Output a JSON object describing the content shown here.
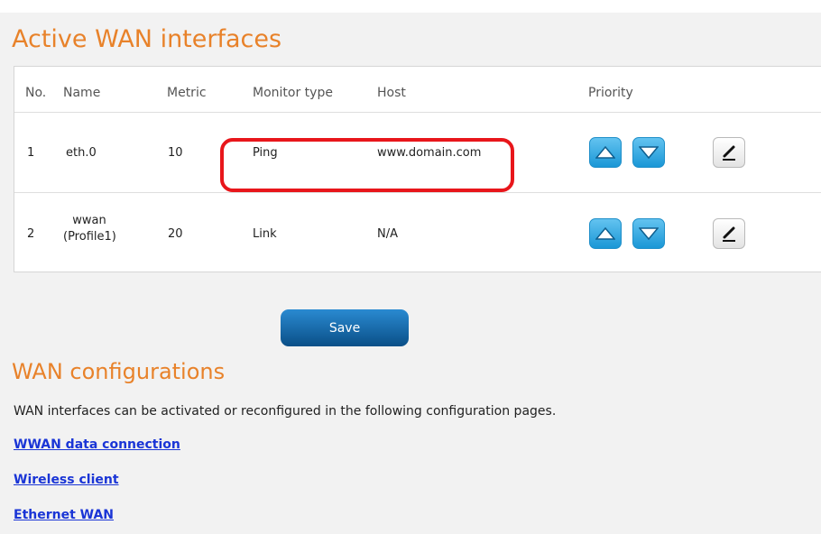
{
  "active": {
    "title": "Active WAN interfaces",
    "headers": {
      "no": "No.",
      "name": "Name",
      "metric": "Metric",
      "monitor": "Monitor type",
      "host": "Host",
      "priority": "Priority"
    },
    "rows": [
      {
        "no": "1",
        "name": "eth.0",
        "metric": "10",
        "monitor": "Ping",
        "host": "www.domain.com"
      },
      {
        "no": "2",
        "name_line1": "wwan",
        "name_line2": "(Profile1)",
        "metric": "20",
        "monitor": "Link",
        "host": "N/A"
      }
    ],
    "highlight_color": "#e8161b"
  },
  "save_label": "Save",
  "config": {
    "title": "WAN configurations",
    "description": "WAN interfaces can be activated or reconfigured in the following configuration pages.",
    "links": [
      "WWAN data connection",
      "Wireless client",
      "Ethernet WAN"
    ]
  },
  "icons": {
    "up": "arrow-up-icon",
    "down": "arrow-down-icon",
    "edit": "pencil-icon"
  },
  "colors": {
    "title": "#e8822a",
    "button": "#1a97d6",
    "save": "#0a4f87",
    "link": "#1a35d6"
  }
}
